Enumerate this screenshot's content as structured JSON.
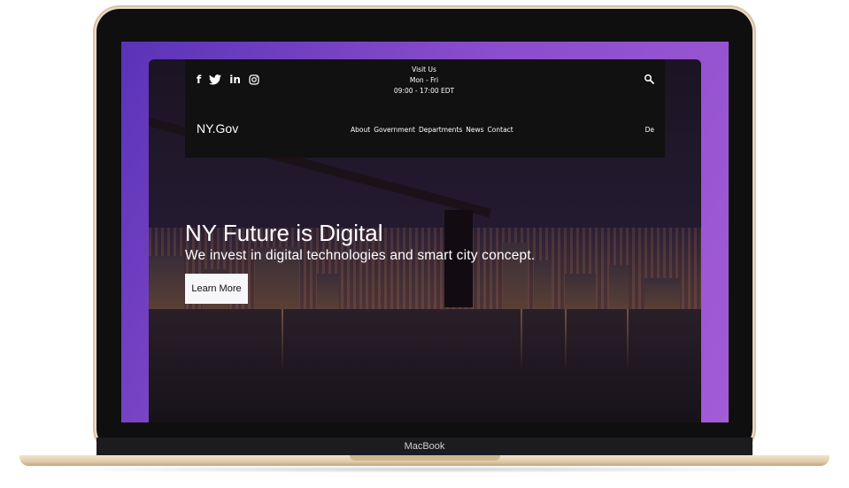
{
  "device": {
    "brand_label": "MacBook"
  },
  "header": {
    "social_icons": [
      "facebook-icon",
      "twitter-icon",
      "linkedin-icon",
      "instagram-icon"
    ],
    "visit": {
      "title": "Visit Us",
      "days": "Mon - Fri",
      "hours": "09:00 - 17:00 EDT"
    },
    "logo": "NY.Gov",
    "nav": [
      "About",
      "Government",
      "Departments",
      "News",
      "Contact"
    ],
    "lang": "De"
  },
  "hero": {
    "title": "NY Future is Digital",
    "subtitle": "We invest in digital technologies and smart city concept.",
    "button_label": "Learn More"
  },
  "colors": {
    "accent_purple": "#8a4dcc",
    "header_bg": "#101110",
    "button_bg": "#f7f7f9"
  }
}
